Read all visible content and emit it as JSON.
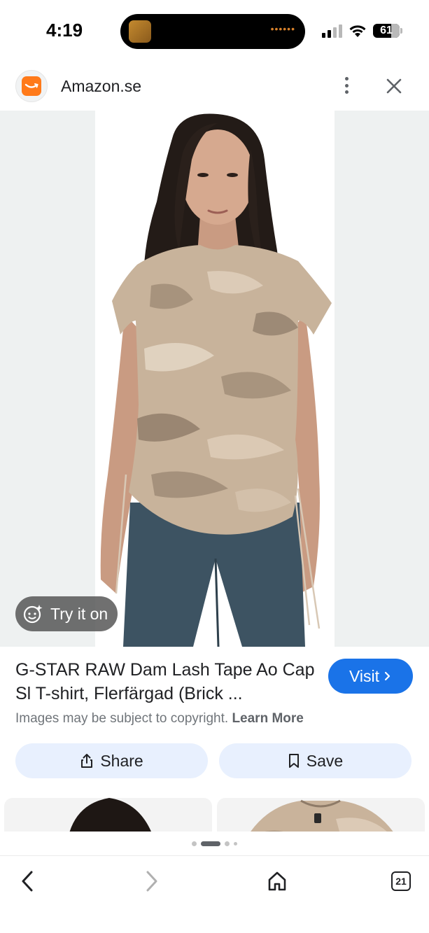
{
  "status_bar": {
    "time": "4:19",
    "battery": "61"
  },
  "site": {
    "name": "Amazon.se",
    "favicon_color": "#ff7a1a"
  },
  "image_overlay": {
    "try_on_label": "Try it on"
  },
  "product": {
    "title": "G-STAR RAW Dam Lash Tape Ao Cap Sl T-shirt, Flerfärgad (Brick ...",
    "visit_label": "Visit",
    "copyright_text": "Images may be subject to copyright.",
    "learn_more": "Learn More"
  },
  "actions": {
    "share_label": "Share",
    "save_label": "Save"
  },
  "pager": {
    "count": 4,
    "active_index": 1
  },
  "bottom_bar": {
    "tab_count": "21"
  },
  "colors": {
    "accent": "#1a73e8",
    "action_bg": "#e8f0fe",
    "image_bg": "#eef1f1"
  }
}
